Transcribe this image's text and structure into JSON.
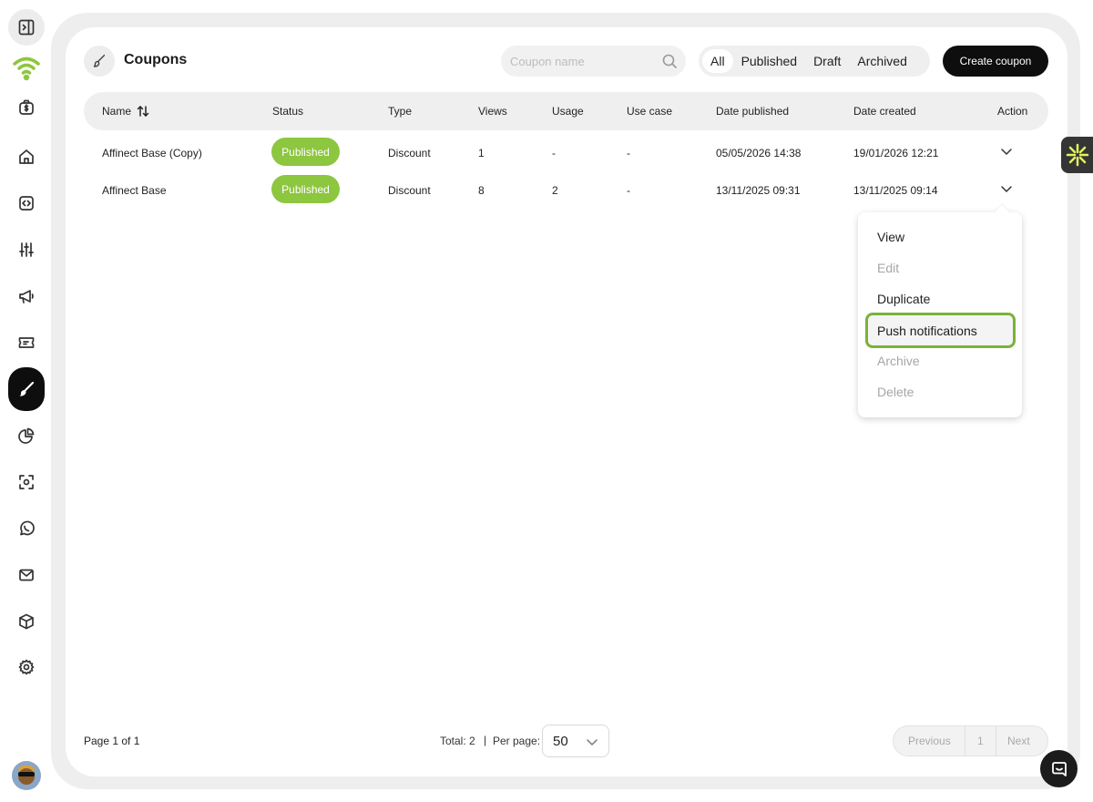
{
  "page": {
    "title": "Coupons"
  },
  "search": {
    "placeholder": "Coupon name",
    "value": ""
  },
  "filters": [
    {
      "label": "All",
      "active": true
    },
    {
      "label": "Published",
      "active": false
    },
    {
      "label": "Draft",
      "active": false
    },
    {
      "label": "Archived",
      "active": false
    }
  ],
  "create_button": "Create coupon",
  "table": {
    "columns": [
      "Name",
      "Status",
      "Type",
      "Views",
      "Usage",
      "Use case",
      "Date published",
      "Date created",
      "Action"
    ],
    "rows": [
      {
        "name": "Affinect Base (Copy)",
        "status": "Published",
        "type": "Discount",
        "views": "1",
        "usage": "-",
        "use_case": "-",
        "date_published": "05/05/2026 14:38",
        "date_created": "19/01/2026 12:21"
      },
      {
        "name": "Affinect Base",
        "status": "Published",
        "type": "Discount",
        "views": "8",
        "usage": "2",
        "use_case": "-",
        "date_published": "13/11/2025 09:31",
        "date_created": "13/11/2025 09:14"
      }
    ]
  },
  "action_menu": {
    "items": [
      {
        "label": "View",
        "enabled": true
      },
      {
        "label": "Edit",
        "enabled": false
      },
      {
        "label": "Duplicate",
        "enabled": true
      },
      {
        "label": "Push notifications",
        "enabled": true,
        "highlighted": true
      },
      {
        "label": "Archive",
        "enabled": false
      },
      {
        "label": "Delete",
        "enabled": false
      }
    ]
  },
  "footer": {
    "page_info": "Page 1 of 1",
    "total": "Total: 2",
    "separator": "|",
    "per_page_label": "Per page:",
    "per_page_value": "50",
    "prev": "Previous",
    "page_number": "1",
    "next": "Next"
  },
  "colors": {
    "accent": "#8dc63f",
    "highlight_border": "#7ab23a",
    "dark": "#0e0e0e"
  },
  "icons": {
    "sidebar": [
      "sidebar-toggle-icon",
      "wifi-logo-icon",
      "money-bag-icon",
      "home-icon",
      "code-icon",
      "sliders-icon",
      "megaphone-icon",
      "ticket-icon",
      "brush-icon",
      "pie-chart-icon",
      "scan-icon",
      "whatsapp-icon",
      "mail-icon",
      "box-icon",
      "gear-icon"
    ]
  }
}
